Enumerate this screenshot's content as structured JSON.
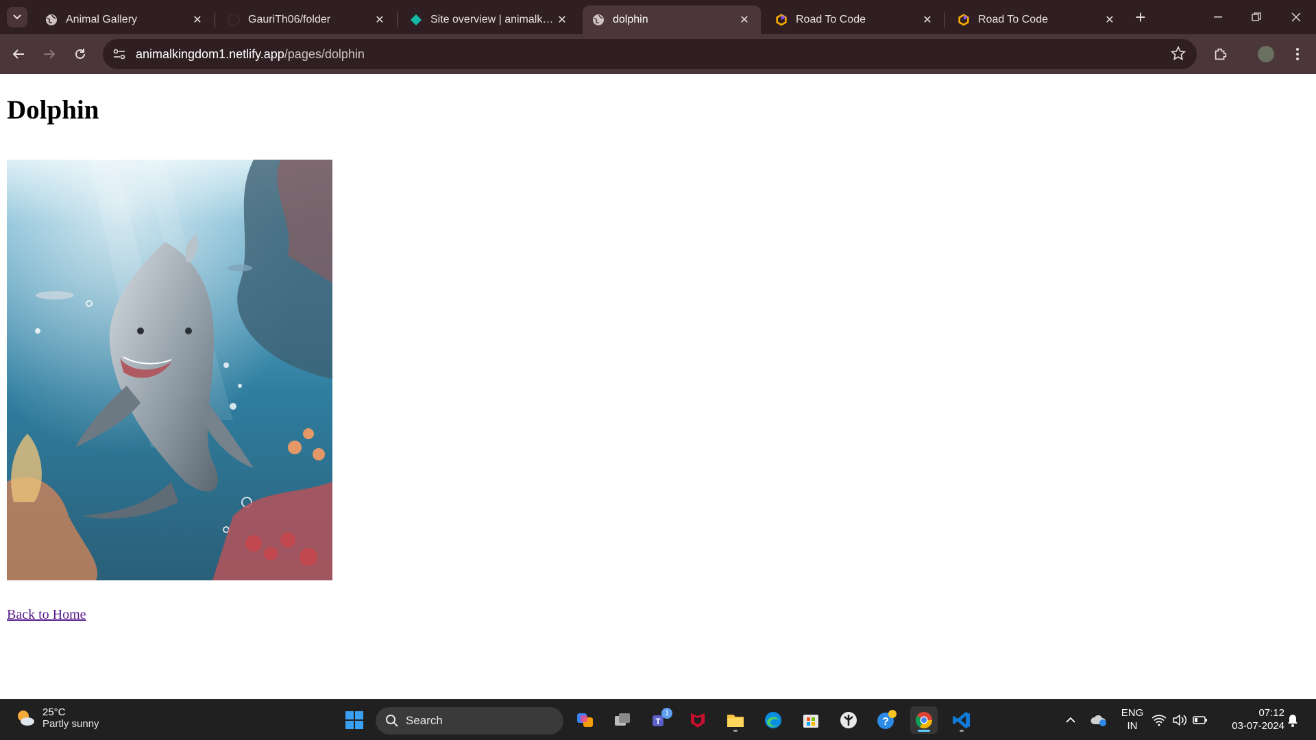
{
  "browser": {
    "tabs": [
      {
        "title": "Animal Gallery",
        "icon": "globe-icon",
        "active": false
      },
      {
        "title": "GauriTh06/folder",
        "icon": "github-icon",
        "active": false
      },
      {
        "title": "Site overview | animalkingdom",
        "icon": "netlify-icon",
        "active": false
      },
      {
        "title": "dolphin",
        "icon": "globe-icon",
        "active": true
      },
      {
        "title": "Road To Code",
        "icon": "roadtocode-icon",
        "active": false
      },
      {
        "title": "Road To Code",
        "icon": "roadtocode-icon",
        "active": false
      }
    ],
    "url_host": "animalkingdom1.netlify.app",
    "url_path": "/pages/dolphin"
  },
  "page": {
    "heading": "Dolphin",
    "image_alt": "Dolphin swimming underwater near coral reef",
    "back_link": "Back to Home"
  },
  "taskbar": {
    "weather_temp": "25°C",
    "weather_cond": "Partly sunny",
    "search_label": "Search",
    "teams_badge": "1",
    "lang_line1": "ENG",
    "lang_line2": "IN",
    "time": "07:12",
    "date": "03-07-2024"
  }
}
